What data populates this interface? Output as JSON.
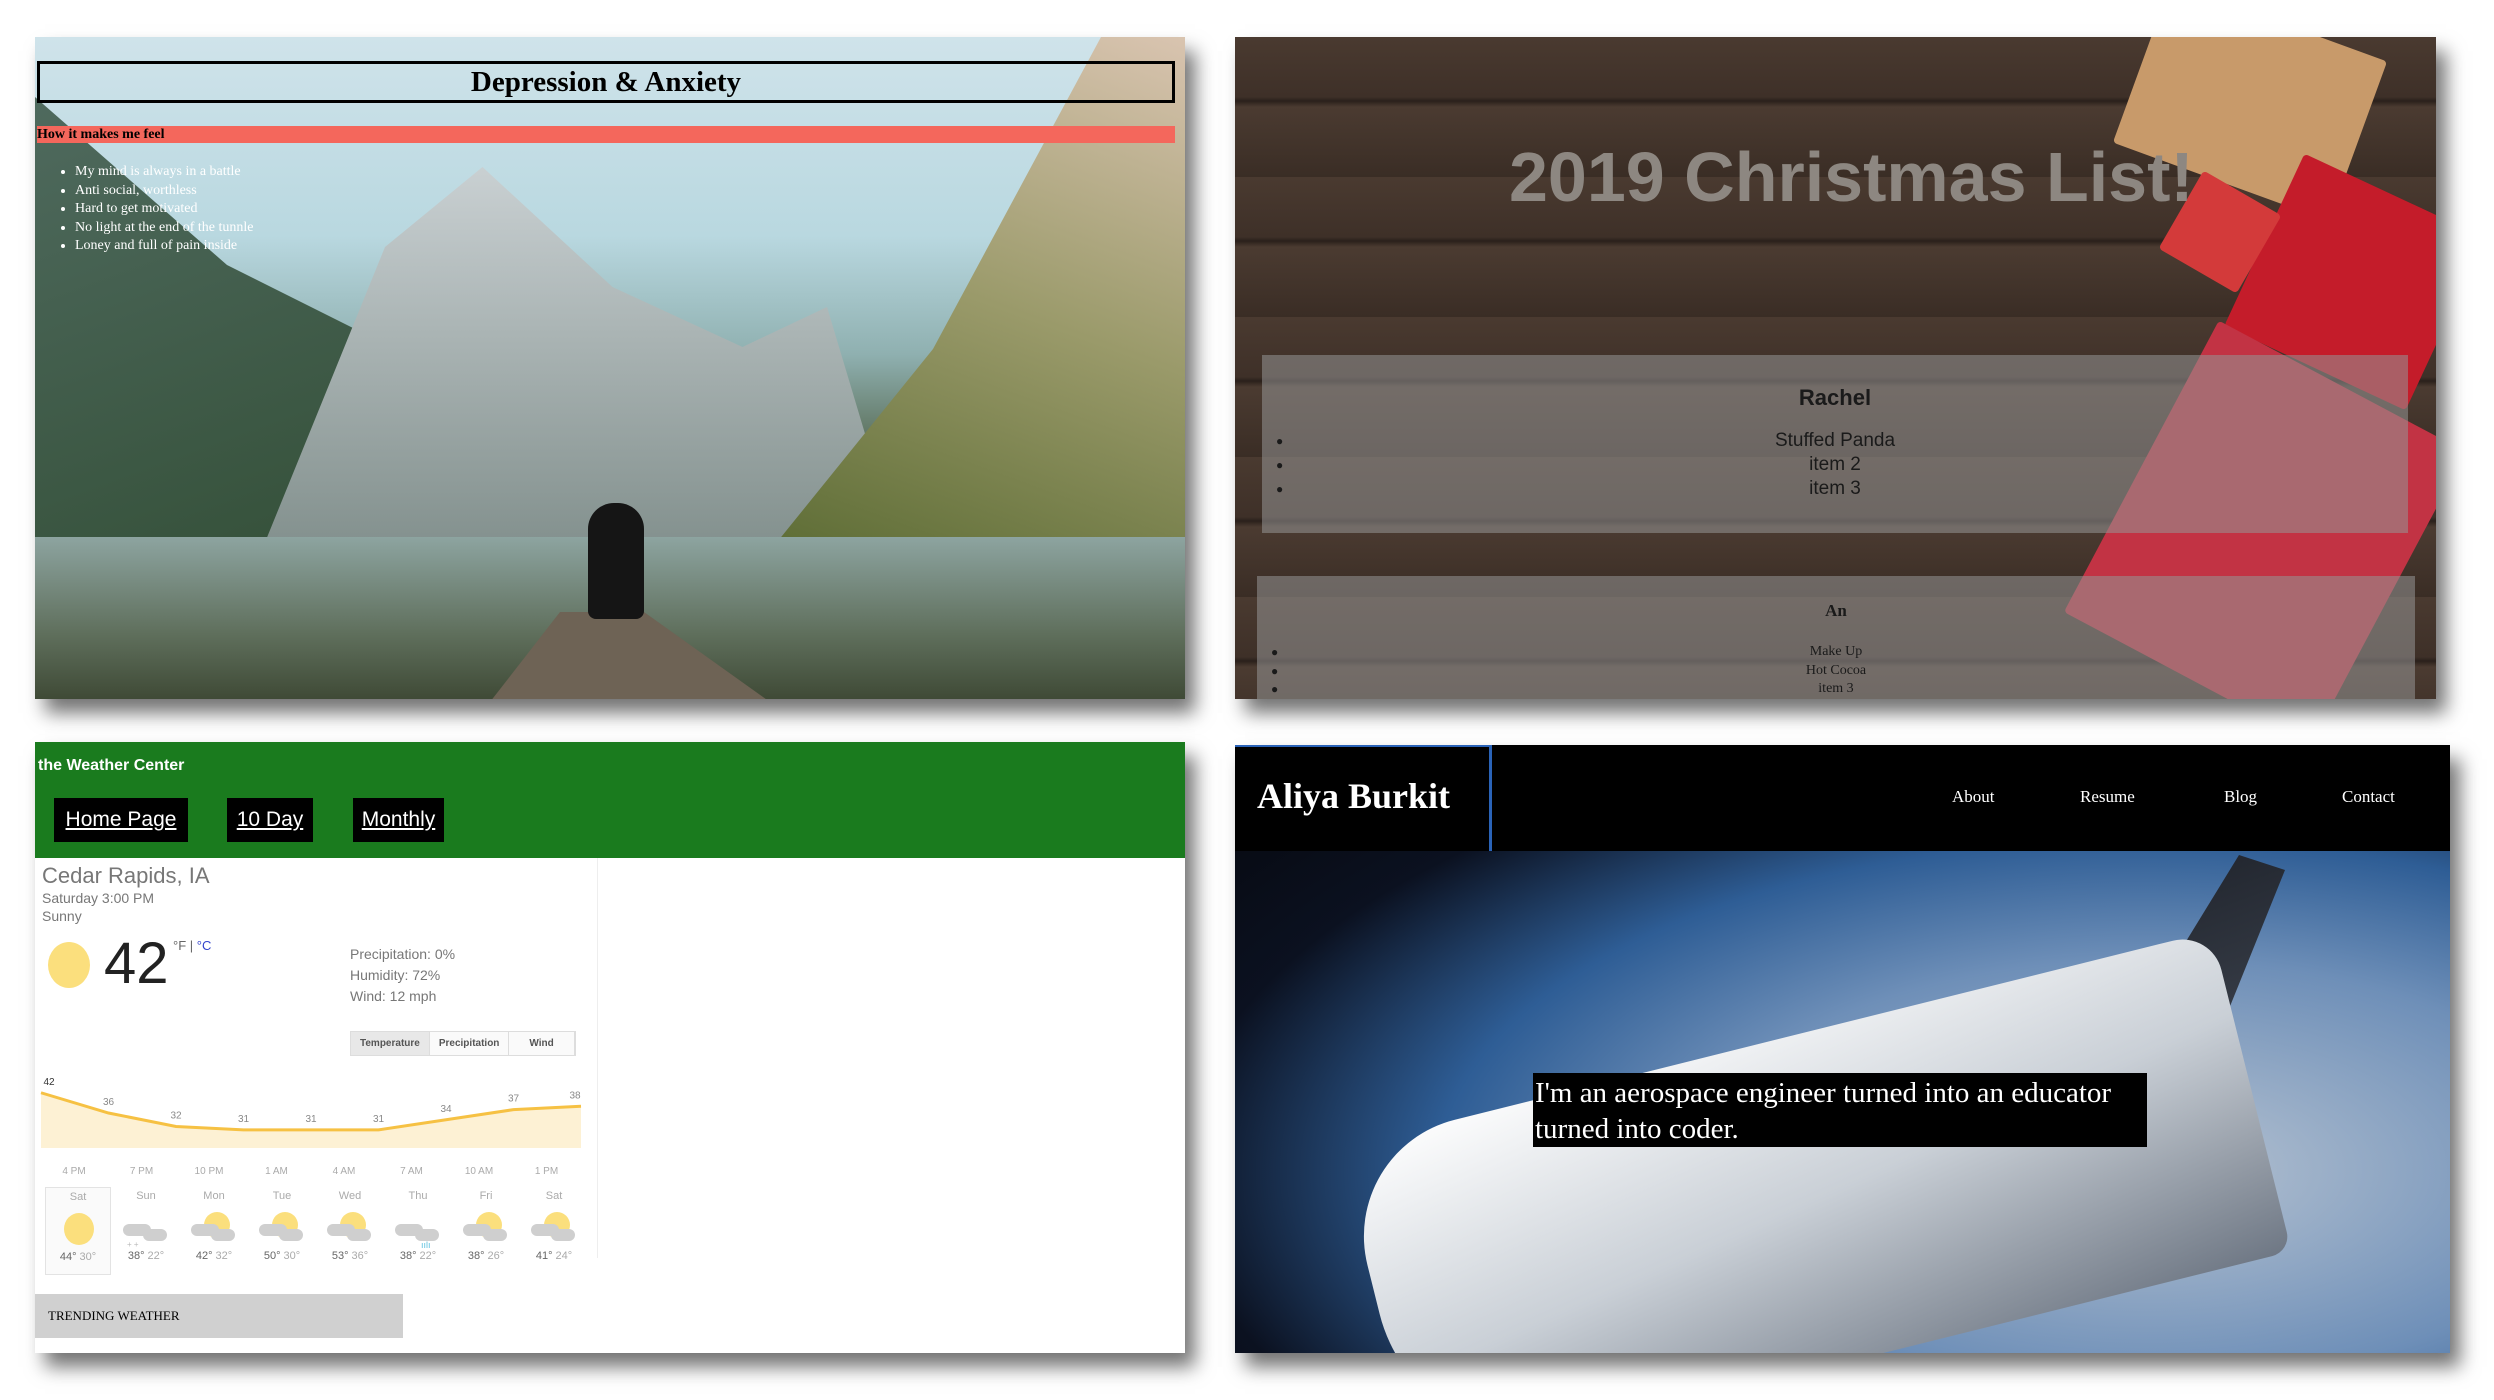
{
  "depression": {
    "title": "Depression & Anxiety",
    "subtitle": "How it makes me feel",
    "items": [
      "My mind is always in a battle",
      "Anti social, worthless",
      "Hard to get motivated",
      "No light at the end of the tunnle",
      "Loney and full of pain inside"
    ]
  },
  "christmas": {
    "title": "2019 Christmas List!",
    "cards": [
      {
        "name": "Rachel",
        "items": [
          "Stuffed Panda",
          "item 2",
          "item 3"
        ]
      },
      {
        "name": "An",
        "items": [
          "Make Up",
          "Hot Cocoa",
          "item 3"
        ]
      }
    ]
  },
  "weather": {
    "brand": "the Weather Center",
    "nav": [
      "Home Page",
      "10 Day",
      "Monthly"
    ],
    "city": "Cedar Rapids, IA",
    "time": "Saturday 3:00 PM",
    "condition": "Sunny",
    "temp": "42",
    "unit_f": "°F",
    "unit_sep": " | ",
    "unit_c": "°C",
    "precipitation": "Precipitation: 0%",
    "humidity": "Humidity: 72%",
    "wind": "Wind: 12 mph",
    "tabs": [
      "Temperature",
      "Precipitation",
      "Wind"
    ],
    "trending": "TRENDING WEATHER",
    "colors": {
      "green": "#1a7b1e",
      "sun": "#fbdf7d",
      "line": "#f6c143"
    },
    "chart_data": {
      "type": "area",
      "values": [
        42,
        36,
        32,
        31,
        31,
        31,
        34,
        37,
        38
      ],
      "x_labels": [
        "4 PM",
        "7 PM",
        "10 PM",
        "1 AM",
        "4 AM",
        "7 AM",
        "10 AM",
        "1 PM"
      ]
    },
    "days": [
      {
        "day": "Sat",
        "hi": "44°",
        "lo": "30°",
        "icon": "sun"
      },
      {
        "day": "Sun",
        "hi": "38°",
        "lo": "22°",
        "icon": "snow-cloud"
      },
      {
        "day": "Mon",
        "hi": "42°",
        "lo": "32°",
        "icon": "partly-cloudy"
      },
      {
        "day": "Tue",
        "hi": "50°",
        "lo": "30°",
        "icon": "partly-cloudy"
      },
      {
        "day": "Wed",
        "hi": "53°",
        "lo": "36°",
        "icon": "partly-cloudy"
      },
      {
        "day": "Thu",
        "hi": "38°",
        "lo": "22°",
        "icon": "rain-snow"
      },
      {
        "day": "Fri",
        "hi": "38°",
        "lo": "26°",
        "icon": "partly-cloudy"
      },
      {
        "day": "Sat",
        "hi": "41°",
        "lo": "24°",
        "icon": "partly-cloudy"
      }
    ]
  },
  "portfolio": {
    "name": "Aliya Burkit",
    "nav": [
      "About",
      "Resume",
      "Blog",
      "Contact"
    ],
    "quote": "I'm an aerospace engineer turned into an educator turned into coder."
  }
}
